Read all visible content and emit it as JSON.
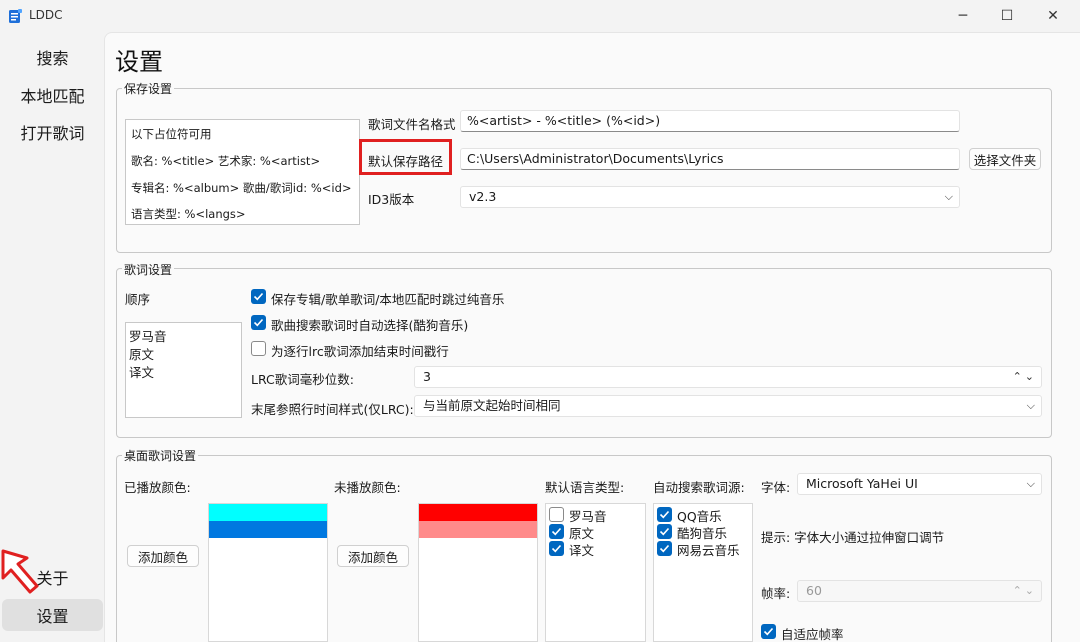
{
  "window": {
    "title": "LDDC",
    "minimize": "─",
    "maximize": "☐",
    "close": "✕"
  },
  "nav": {
    "search": "搜索",
    "local_match": "本地匹配",
    "open_lyrics": "打开歌词",
    "about": "关于",
    "settings": "设置"
  },
  "page_title": "设置",
  "save_settings": {
    "title": "保存设置",
    "placeholders_header": "以下占位符可用",
    "placeholder_lines": [
      "歌名: %<title> 艺术家: %<artist>",
      "专辑名: %<album> 歌曲/歌词id: %<id>",
      "语言类型: %<langs>"
    ],
    "filename_label": "歌词文件名格式",
    "filename_value": "%<artist> - %<title> (%<id>)",
    "path_label": "默认保存路径",
    "path_value": "C:\\Users\\Administrator\\Documents\\Lyrics",
    "choose_folder": "选择文件夹",
    "id3_label": "ID3版本",
    "id3_value": "v2.3"
  },
  "lyrics_settings": {
    "title": "歌词设置",
    "order_label": "顺序",
    "order_items": [
      "罗马音",
      "原文",
      "译文"
    ],
    "check_skip": "保存专辑/歌单歌词/本地匹配时跳过纯音乐",
    "check_auto": "歌曲搜索歌词时自动选择(酷狗音乐)",
    "check_endtime": "为逐行lrc歌词添加结束时间戳行",
    "ms_label": "LRC歌词毫秒位数:",
    "ms_value": "3",
    "last_line_label": "末尾参照行时间样式(仅LRC):",
    "last_line_value": "与当前原文起始时间相同"
  },
  "desktop_settings": {
    "title": "桌面歌词设置",
    "played_label": "已播放颜色:",
    "unplayed_label": "未播放颜色:",
    "add_color": "添加颜色",
    "played_colors": [
      "#00ffff",
      "#0078e0"
    ],
    "unplayed_colors": [
      "#ff0000",
      "#ff8a8a"
    ],
    "lang_label": "默认语言类型:",
    "langs": [
      "罗马音",
      "原文",
      "译文"
    ],
    "source_label": "自动搜索歌词源:",
    "sources": [
      "QQ音乐",
      "酷狗音乐",
      "网易云音乐"
    ],
    "font_label": "字体:",
    "font_value": "Microsoft YaHei UI",
    "hint": "提示: 字体大小通过拉伸窗口调节",
    "fps_label": "帧率:",
    "fps_value": "60",
    "adaptive_fps": "自适应帧率"
  }
}
